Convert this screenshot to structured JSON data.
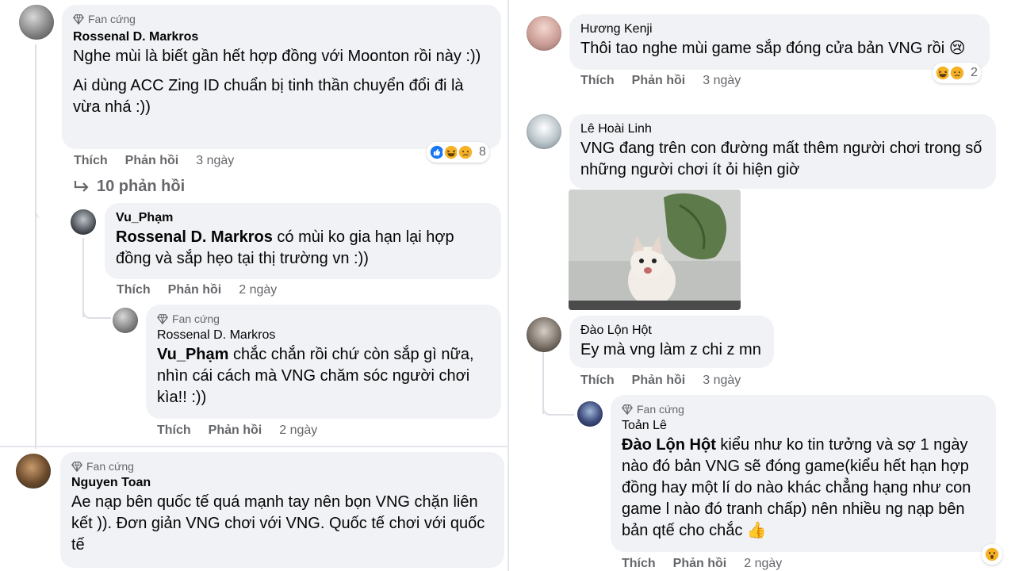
{
  "left": {
    "c1": {
      "badge": "Fan cứng",
      "author": "Rossenal D. Markros",
      "line1": "Nghe mùi là biết gần hết hợp đồng với Moonton rồi này :))",
      "line2": "Ai dùng ACC Zing ID chuẩn bị tinh thần chuyển đổi đi là vừa nhá :))",
      "like": "Thích",
      "reply": "Phản hồi",
      "time": "3 ngày",
      "reaction_count": "8",
      "reactions": [
        "like-reaction-icon",
        "haha-reaction-icon",
        "sad-reaction-icon"
      ],
      "more_replies": "10 phản hồi"
    },
    "c2": {
      "author": "Vu_Phạm",
      "mention": "Rossenal D. Markros",
      "text": " có mùi ko gia hạn lại hợp đồng và sắp hẹo tại thị trường vn :))",
      "like": "Thích",
      "reply": "Phản hồi",
      "time": "2 ngày"
    },
    "c3": {
      "badge": "Fan cứng",
      "author": "Rossenal D. Markros",
      "mention": "Vu_Phạm",
      "text": " chắc chắn rồi chứ còn sắp gì nữa, nhìn cái cách mà VNG chăm sóc người chơi kìa!! :))",
      "like": "Thích",
      "reply": "Phản hồi",
      "time": "2 ngày"
    },
    "c4": {
      "badge": "Fan cứng",
      "author": "Nguyen Toan",
      "text": "Ae nạp bên quốc tế quá mạnh tay nên bọn VNG chặn liên kết )). Đơn giản VNG chơi với VNG. Quốc tế chơi với quốc tế"
    }
  },
  "right": {
    "c1": {
      "author": "Hương Kenji",
      "text": "Thôi tao nghe mùi game sắp đóng cửa bản VNG rồi 😢",
      "like": "Thích",
      "reply": "Phản hồi",
      "time": "3 ngày",
      "reaction_count": "2",
      "reactions": [
        "haha-reaction-icon",
        "sad-reaction-icon"
      ]
    },
    "c2": {
      "author": "Lê Hoài Linh",
      "text": "VNG đang trên con đường mất thêm người chơi trong số những người chơi ít ỏi hiện giờ",
      "photo": "cat-photo"
    },
    "c3": {
      "author": "Đào Lộn Hột",
      "text": "Ey mà vng làm z chi z mn",
      "like": "Thích",
      "reply": "Phản hồi",
      "time": "3 ngày"
    },
    "c4": {
      "badge": "Fan cứng",
      "author": "Toản Lê",
      "mention": "Đào Lộn Hột",
      "text": " kiểu như ko tin tưởng và sợ 1 ngày nào đó bản VNG sẽ đóng game(kiểu hết hạn hợp đồng hay một lí do nào khác chẳng hạng như con game l nào đó tranh chấp) nên nhiều ng nạp bên bản qtế cho chắc 👍",
      "like": "Thích",
      "reply": "Phản hồi",
      "time": "2 ngày",
      "reactions": [
        "wow-reaction-icon"
      ]
    }
  },
  "colors": {
    "bubble": "#f0f2f5",
    "meta": "#65676b",
    "text": "#050505",
    "like_blue": "#1877f2",
    "emoji_yellow": "#f7b125"
  }
}
